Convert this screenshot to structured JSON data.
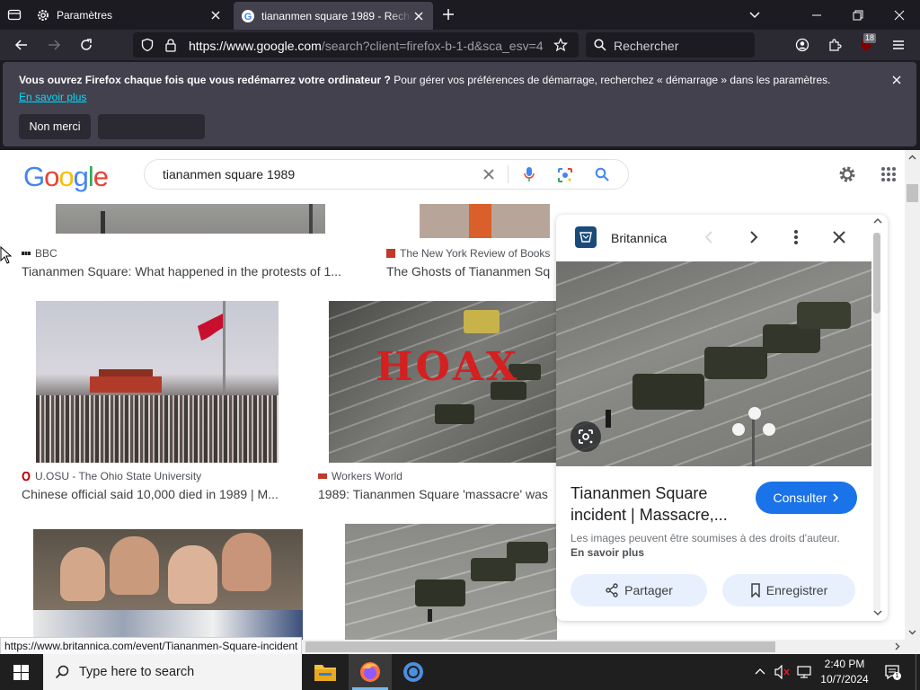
{
  "browser": {
    "tabs": [
      {
        "label": "Paramètres",
        "active": false
      },
      {
        "label": "tiananmen square 1989 - Recherche",
        "active": true
      }
    ],
    "url_main": "https://www.google.com",
    "url_rest": "/search?client=firefox-b-1-d&sca_esv=4",
    "search_placeholder": "Rechercher",
    "extension_badge": "18"
  },
  "notification": {
    "bold": "Vous ouvrez Firefox chaque fois que vous redémarrez votre ordinateur ?",
    "text": " Pour gérer vos préférences de démarrage, recherchez « démarrage » dans les paramètres.",
    "learn_more": "En savoir plus",
    "no_thanks": "Non merci"
  },
  "google": {
    "logo": "Google",
    "query": "tiananmen square 1989"
  },
  "results": [
    {
      "source": "BBC",
      "title": "Tiananmen Square: What happened in the protests of 1..."
    },
    {
      "source": "The New York Review of Books",
      "title": "The Ghosts of Tiananmen Sq"
    },
    {
      "source": "U.OSU - The Ohio State University",
      "title": "Chinese official said 10,000 died in 1989 | M..."
    },
    {
      "source": "Workers World",
      "title": "1989: Tiananmen Square 'massacre' was"
    }
  ],
  "hoax_text": "HOAX",
  "panel": {
    "source": "Britannica",
    "title": "Tiananmen Square incident | Massacre,...",
    "visit": "Consulter",
    "note": "Les images peuvent être soumises à des droits d'auteur.",
    "note_link": "En savoir plus",
    "share": "Partager",
    "save": "Enregistrer"
  },
  "status_url": "https://www.britannica.com/event/Tiananmen-Square-incident",
  "taskbar": {
    "search_placeholder": "Type here to search",
    "time": "2:40 PM",
    "date": "10/7/2024"
  },
  "colors": {
    "google_blue": "#4285F4",
    "google_red": "#EA4335",
    "google_yellow": "#FBBC05",
    "google_green": "#34A853",
    "accent_link": "#1a73e8"
  }
}
